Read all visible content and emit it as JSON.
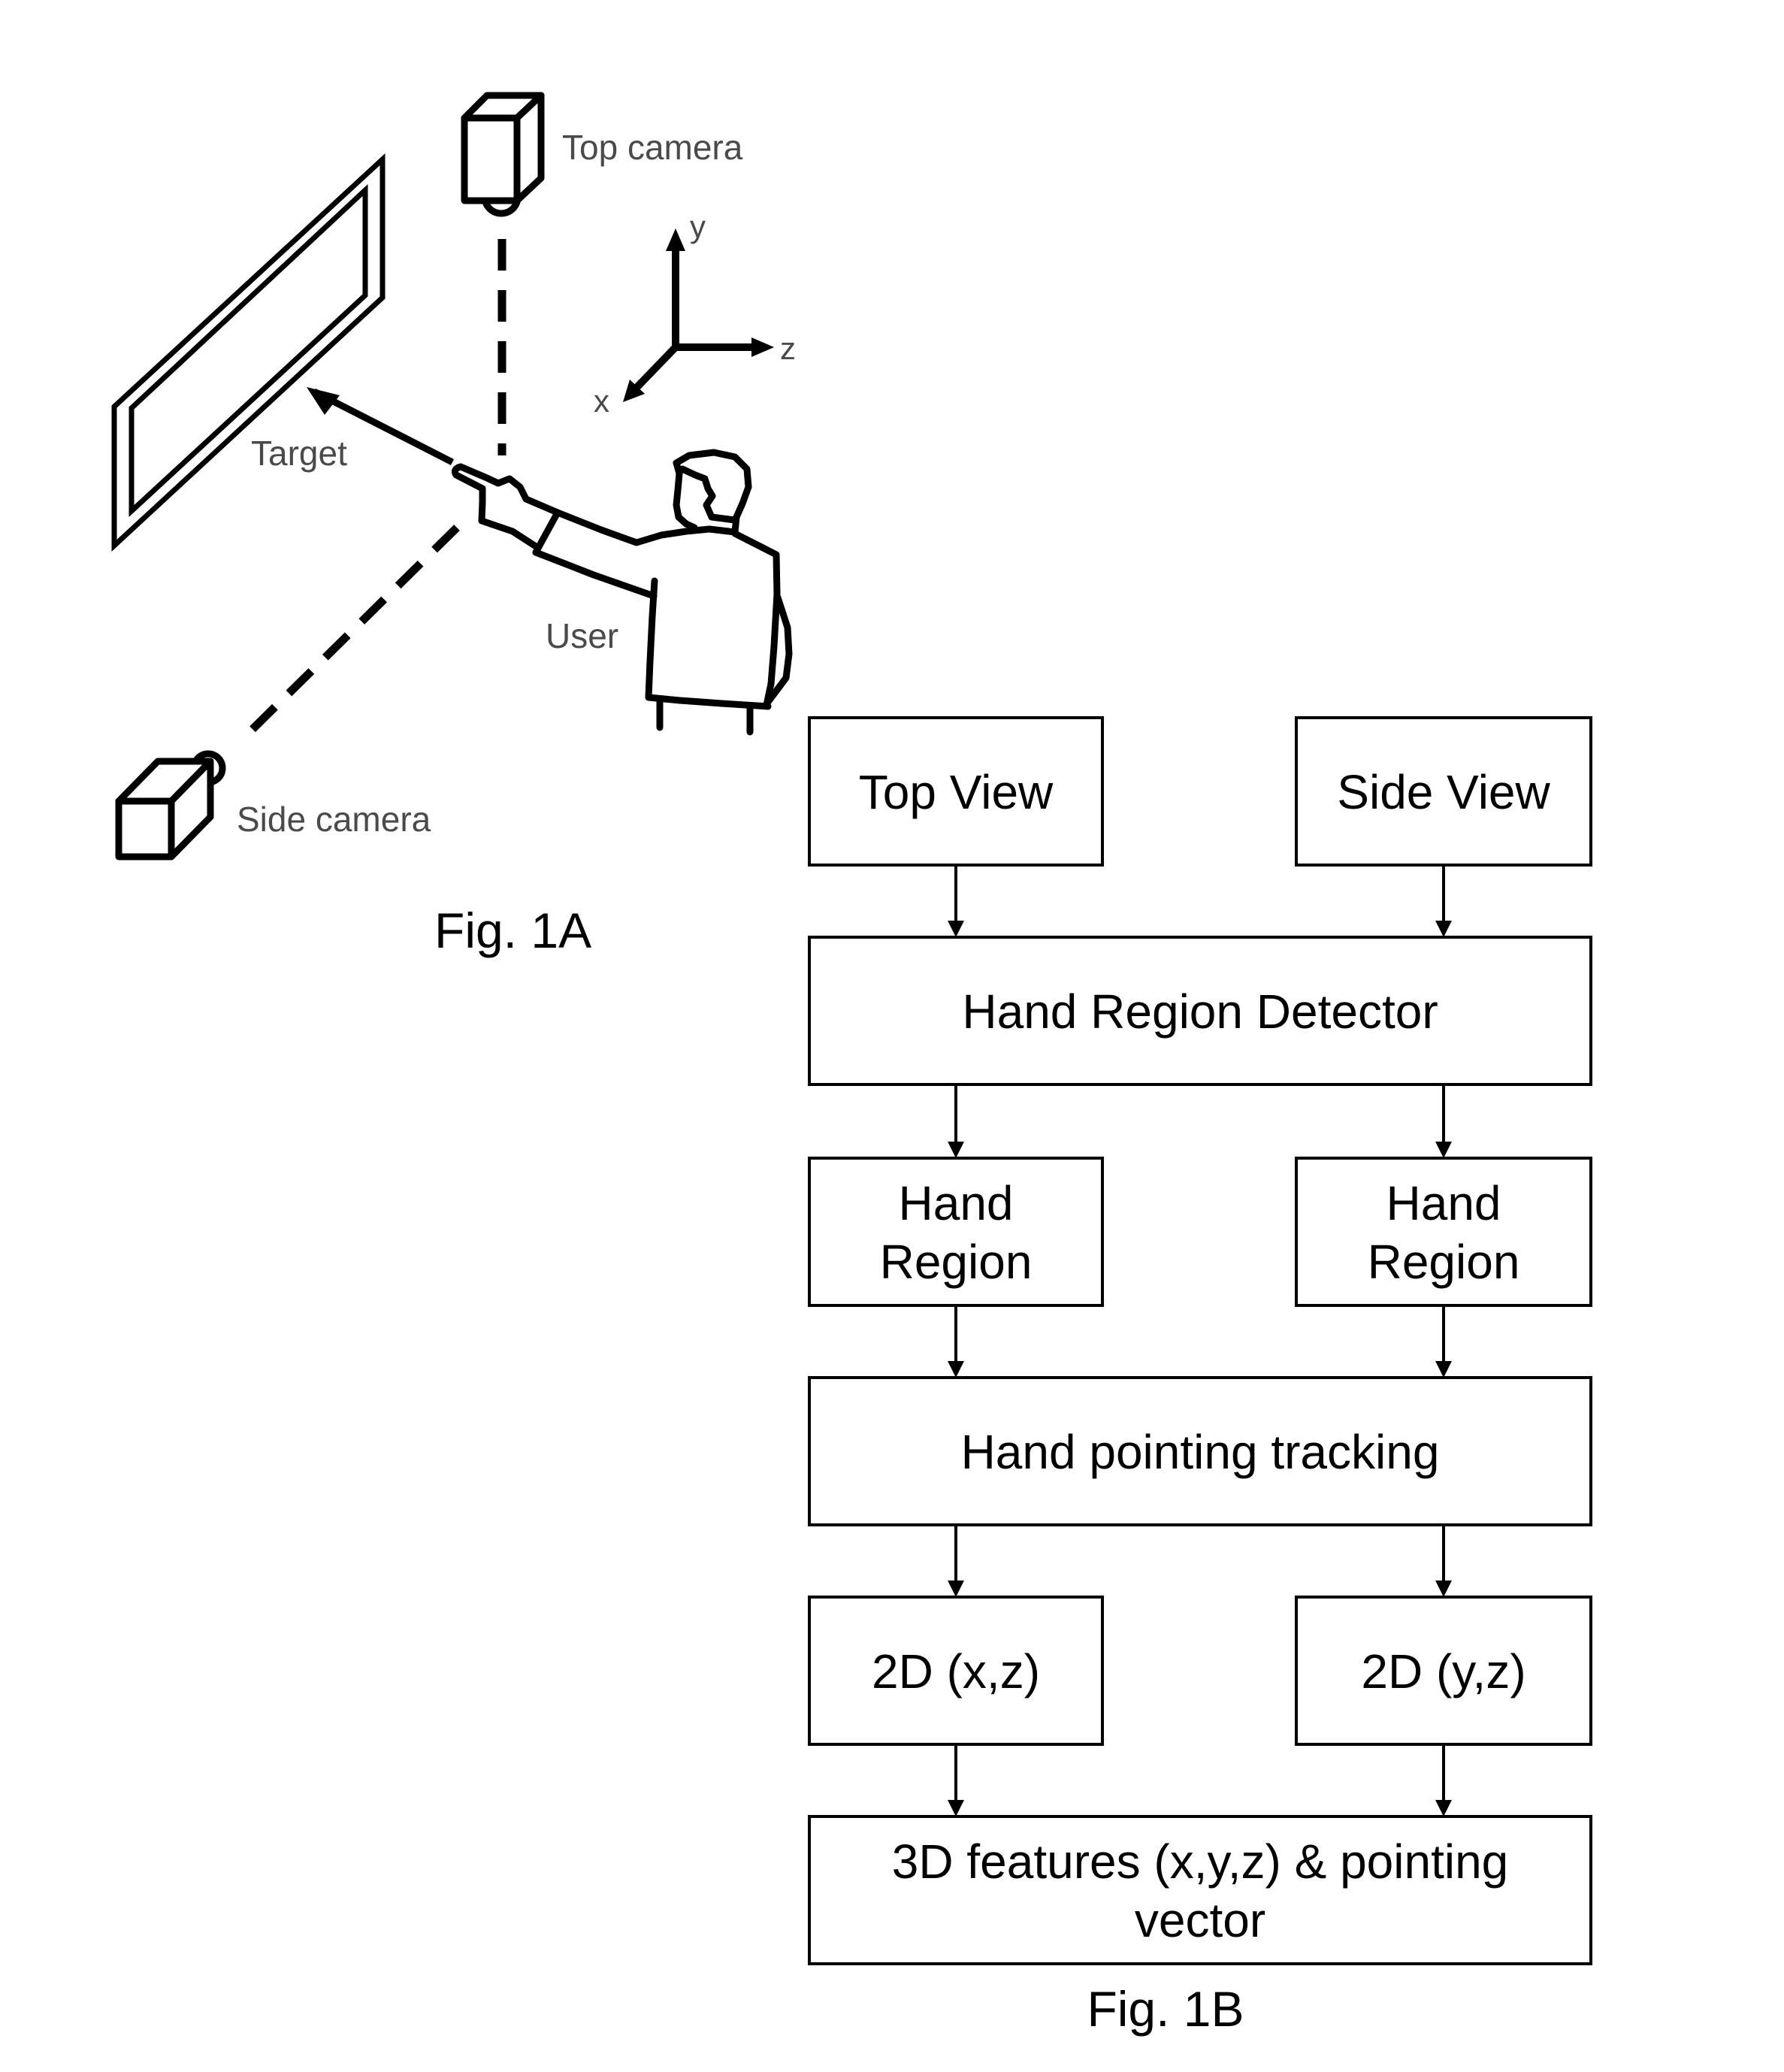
{
  "fig1a": {
    "caption": "Fig. 1A",
    "labels": {
      "top_camera": "Top camera",
      "side_camera": "Side camera",
      "target": "Target",
      "user": "User"
    },
    "axes": {
      "x": "x",
      "y": "y",
      "z": "z"
    }
  },
  "fig1b": {
    "caption": "Fig. 1B",
    "nodes": {
      "top_view": [
        "Top View"
      ],
      "side_view": [
        "Side View"
      ],
      "hand_region_detector": [
        "Hand Region Detector"
      ],
      "hand_region_left": [
        "Hand",
        "Region"
      ],
      "hand_region_right": [
        "Hand",
        "Region"
      ],
      "hand_pointing_tracking": [
        "Hand pointing tracking"
      ],
      "coords_xz": [
        "2D (x,z)"
      ],
      "coords_yz": [
        "2D (y,z)"
      ],
      "features_3d": [
        "3D features (x,y,z) & pointing",
        "vector"
      ]
    },
    "edges": [
      [
        "top_view",
        "hand_region_detector"
      ],
      [
        "side_view",
        "hand_region_detector"
      ],
      [
        "hand_region_detector",
        "hand_region_left"
      ],
      [
        "hand_region_detector",
        "hand_region_right"
      ],
      [
        "hand_region_left",
        "hand_pointing_tracking"
      ],
      [
        "hand_region_right",
        "hand_pointing_tracking"
      ],
      [
        "hand_pointing_tracking",
        "coords_xz"
      ],
      [
        "hand_pointing_tracking",
        "coords_yz"
      ],
      [
        "coords_xz",
        "features_3d"
      ],
      [
        "coords_yz",
        "features_3d"
      ]
    ]
  }
}
